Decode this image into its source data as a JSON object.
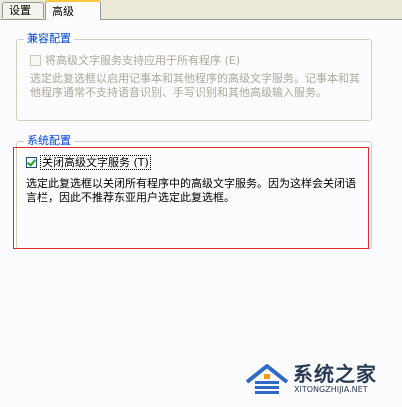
{
  "tabs": [
    {
      "label": "设置",
      "selected": false
    },
    {
      "label": "高级",
      "selected": true
    }
  ],
  "compat_group": {
    "title": "兼容配置",
    "checkbox_label": "将高级文字服务支持应用于所有程序 (E)",
    "checked": false,
    "enabled": false,
    "description": "选定此复选框以启用记事本和其他程序的高级文字服务。记事本和其他程序通常不支持语音识别、手写识别和其他高级输入服务。"
  },
  "system_group": {
    "title": "系统配置",
    "checkbox_label": "关闭高级文字服务 (T)",
    "checked": true,
    "enabled": true,
    "description": "选定此复选框以关闭所有程序中的高级文字服务。因为这样会关闭语言栏，因此不推荐东亚用户选定此复选框。"
  },
  "watermark": {
    "title": "系统之家",
    "url": "XITONGZHIJIA.NET"
  },
  "colors": {
    "group_title": "#0046d5",
    "highlight_box": "#e8262d",
    "disabled_text": "#aca899"
  }
}
